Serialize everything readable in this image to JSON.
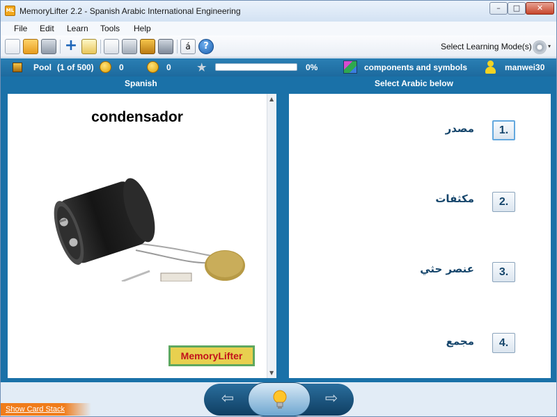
{
  "window": {
    "app_icon_text": "ML",
    "title": "MemoryLifter 2.2 - Spanish Arabic International Engineering",
    "controls": {
      "minimize": "–",
      "maximize": "□",
      "close": "✕"
    }
  },
  "menu": {
    "items": [
      "File",
      "Edit",
      "Learn",
      "Tools",
      "Help"
    ]
  },
  "toolbar": {
    "icons": [
      "new-icon",
      "open-icon",
      "print-icon",
      "add-icon",
      "edit-icon",
      "slideshow-icon",
      "print-cards-icon",
      "card-stack-icon",
      "tools-icon",
      "character-map-icon",
      "help-icon"
    ],
    "character_map_glyph": "á",
    "help_glyph": "?",
    "learning_mode_label": "Select Learning Mode(s)",
    "caret": "▾"
  },
  "status": {
    "pool_label": "Pool",
    "pool_count": "(1 of 500)",
    "correct_count": "0",
    "wrong_count": "0",
    "progress_fraction": 0,
    "progress_percent": "0%",
    "chapter": "components and symbols",
    "user": "manwei30",
    "star_glyph": "★"
  },
  "question": {
    "header": "Spanish",
    "word": "condensador",
    "image_desc_icon": "capacitor-image",
    "logo_text": "MemoryLifter"
  },
  "answers": {
    "header": "Select Arabic below",
    "choices": [
      {
        "number": "1.",
        "text": "مصدر"
      },
      {
        "number": "2.",
        "text": "مكثفات"
      },
      {
        "number": "3.",
        "text": "عنصر حثي"
      },
      {
        "number": "4.",
        "text": "مجمع"
      }
    ]
  },
  "navigation": {
    "back_glyph": "⇦",
    "forward_glyph": "⇨",
    "show_card_stack": "Show Card Stack"
  },
  "colors": {
    "accent_blue": "#1a71a8",
    "answer_text": "#15456b",
    "stack_orange": "#f07c1a"
  }
}
